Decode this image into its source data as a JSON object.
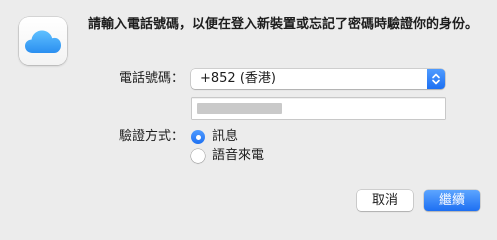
{
  "app_icon": {
    "name": "icloud-icon",
    "color": "#3ba8f5"
  },
  "message": "請輸入電話號碼，以便在登入新裝置或忘記了密碼時驗證你的身份。",
  "phone": {
    "label": "電話號碼：",
    "country_code": "+852 (香港)",
    "number_value": ""
  },
  "verification": {
    "label": "驗證方式：",
    "options": [
      {
        "label": "訊息",
        "selected": true
      },
      {
        "label": "語音來電",
        "selected": false
      }
    ]
  },
  "buttons": {
    "cancel": "取消",
    "continue": "繼續"
  },
  "colors": {
    "accent": "#1d70f2",
    "background": "#ececec"
  }
}
